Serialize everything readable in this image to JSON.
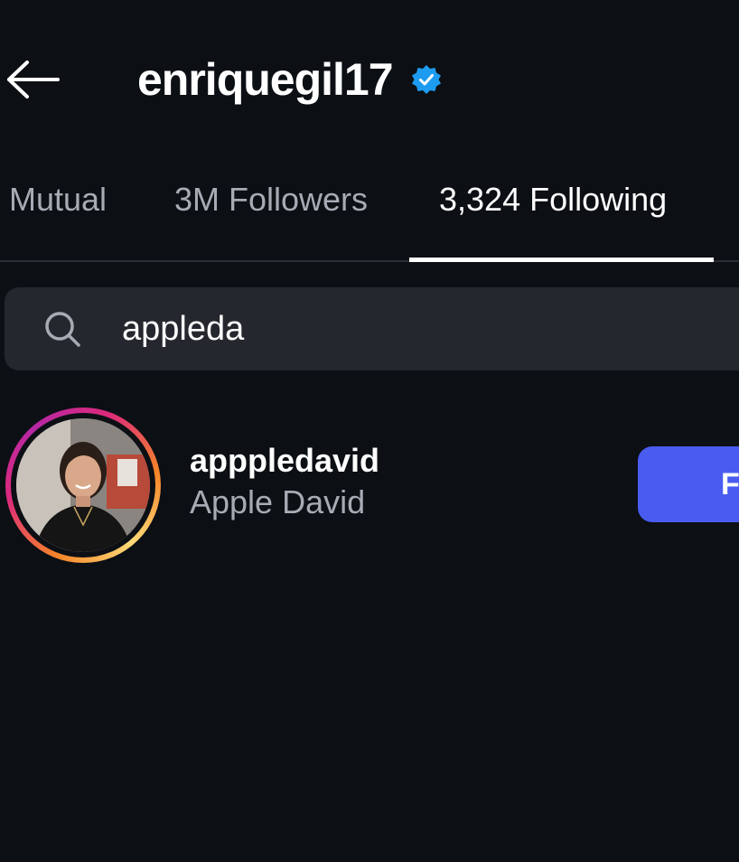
{
  "header": {
    "back_icon": "arrow-left-icon",
    "title": "enriquegil17",
    "verified_icon": "verified-badge-icon",
    "verified_color": "#1d9bf0"
  },
  "tabs": [
    {
      "label": "Mutual",
      "active": false
    },
    {
      "label": "3M Followers",
      "active": false
    },
    {
      "label": "3,324 Following",
      "active": true
    }
  ],
  "search": {
    "icon": "search-icon",
    "value": "appleda"
  },
  "results": [
    {
      "username": "apppledavid",
      "full_name": "Apple David",
      "button_label": "Follow",
      "button_visible_text": "F",
      "story_ring": true
    }
  ],
  "colors": {
    "background": "#0c0f14",
    "search_bg": "#24272e",
    "secondary_text": "#a7abb4",
    "button_bg": "#4a5cf0"
  }
}
